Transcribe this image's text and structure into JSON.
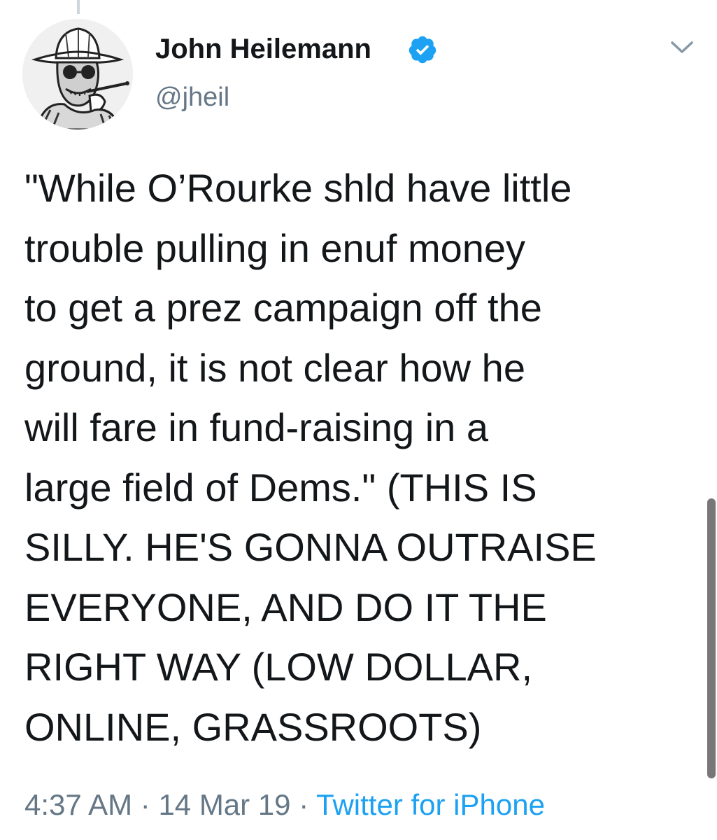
{
  "tweet": {
    "author": {
      "name": "John Heilemann",
      "handle": "@jheil",
      "verified": true
    },
    "text": "\"While O’Rourke shld have little\ntrouble pulling in enuf money\nto get a prez campaign off the\nground, it is not clear how he\nwill fare in fund-raising in a\nlarge field of Dems.\" (THIS IS\nSILLY. HE'S GONNA OUTRAISE\nEVERYONE, AND DO IT THE\nRIGHT WAY (LOW DOLLAR,\nONLINE, GRASSROOTS)",
    "time": "4:37 AM",
    "separator": " · ",
    "date": "14 Mar 19",
    "source": "Twitter for iPhone"
  },
  "icons": {
    "verified": "verified-badge-icon",
    "menu": "chevron-down-icon"
  },
  "colors": {
    "text": "#14171a",
    "secondary": "#657786",
    "link": "#1da1f2",
    "verified": "#1da1f2"
  }
}
